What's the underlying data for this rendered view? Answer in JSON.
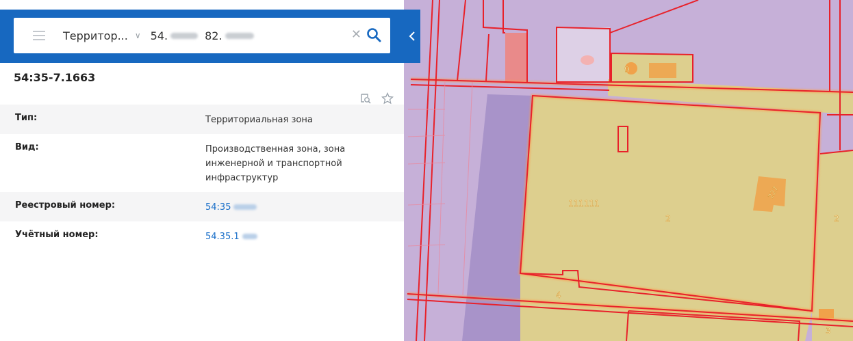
{
  "search": {
    "type_label": "Территор...",
    "coord_lat": "54.",
    "coord_lon": "82."
  },
  "object": {
    "cadastral_number": "54:35-7.1663"
  },
  "properties": [
    {
      "label": "Тип:",
      "value": "Территориальная зона",
      "link": false
    },
    {
      "label": "Вид:",
      "value": "Производственная зона, зона инженерной и транспортной инфраструктур",
      "link": false
    },
    {
      "label": "Реестровый номер:",
      "value": "54:35",
      "link": true
    },
    {
      "label": "Учётный номер:",
      "value": "54.35.1",
      "link": true
    }
  ],
  "map_labels": {
    "parcel_9": "9",
    "parcel_111111": "111111",
    "parcel_2_center": "2",
    "parcel_2_right": "2",
    "parcel_4": "4",
    "parcel_3_bottom": "3",
    "building_227": "227"
  },
  "icons": [
    "menu-icon",
    "chevron-down-icon",
    "close-icon",
    "search-icon",
    "chevron-left-icon",
    "zoom-to-object-icon",
    "star-icon"
  ],
  "colors": {
    "accent": "#1768c0",
    "link": "#1a6fc9",
    "zone_purple": "#c6b0d8",
    "zone_purple_dark": "#a893c9",
    "parcel_fill": "#ddcf8e",
    "building_orange": "#f0a24a",
    "boundary_red": "#e8212a"
  }
}
